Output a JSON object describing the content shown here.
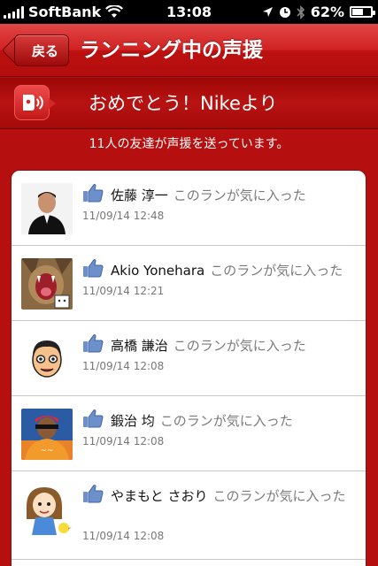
{
  "status_bar": {
    "carrier": "SoftBank",
    "time": "13:08",
    "battery_percent": "62%",
    "battery_level": 0.62
  },
  "nav": {
    "back_label": "戻る",
    "title": "ランニング中の声援"
  },
  "banner": {
    "text": "おめでとう！Nikeより",
    "icon": "cheer-speaker-icon"
  },
  "summary": "11人の友達が声援を送っています。",
  "action_text": "このランが気に入った",
  "cheers": [
    {
      "name": "佐藤 淳一",
      "timestamp": "11/09/14  12:48",
      "avatar": "photo-man-suit"
    },
    {
      "name": "Akio Yonehara",
      "timestamp": "11/09/14  12:21",
      "avatar": "photo-cat-yawn"
    },
    {
      "name": "高橋 謙治",
      "timestamp": "11/09/14  12:08",
      "avatar": "cartoon-man"
    },
    {
      "name": "鍛治 均",
      "timestamp": "11/09/14  12:08",
      "avatar": "photo-cyclist"
    },
    {
      "name": "やまもと さおり",
      "timestamp": "11/09/14  12:08",
      "avatar": "cartoon-girl"
    }
  ],
  "colors": {
    "brand_red": "#c91b1b",
    "like_blue": "#5a7dbd"
  }
}
